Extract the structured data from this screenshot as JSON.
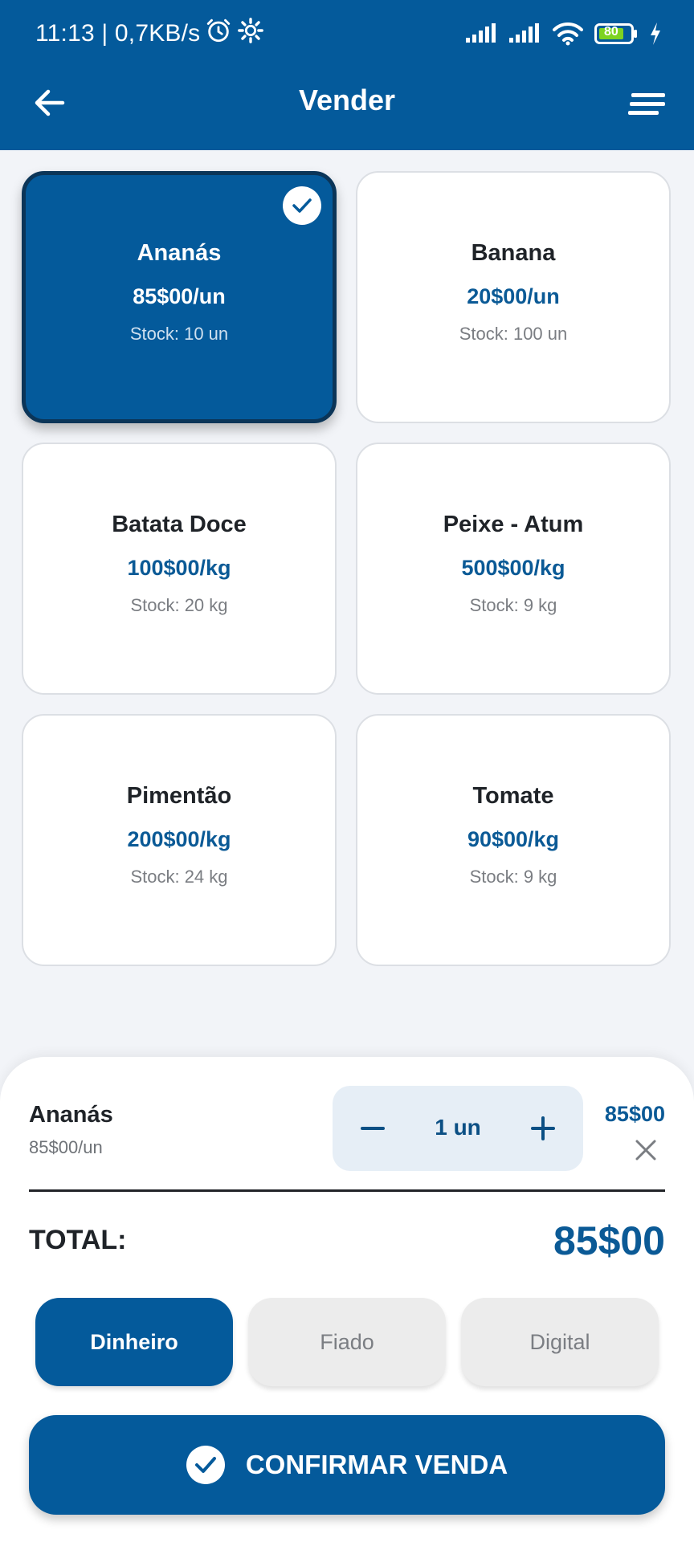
{
  "status_bar": {
    "time_speed": "11:13 | 0,7KB/s",
    "battery": "80",
    "icons": [
      "alarm-icon",
      "settings-icon",
      "signal-icon",
      "signal-icon",
      "wifi-icon",
      "battery-icon",
      "charging-icon"
    ]
  },
  "app_bar": {
    "title": "Vender",
    "back_icon": "arrow-left-icon",
    "menu_icon": "sort-menu-icon"
  },
  "products": [
    {
      "name": "Ananás",
      "price": "85$00/un",
      "stock": "Stock: 10 un",
      "selected": true
    },
    {
      "name": "Banana",
      "price": "20$00/un",
      "stock": "Stock: 100 un",
      "selected": false
    },
    {
      "name": "Batata Doce",
      "price": "100$00/kg",
      "stock": "Stock: 20 kg",
      "selected": false
    },
    {
      "name": "Peixe - Atum",
      "price": "500$00/kg",
      "stock": "Stock: 9 kg",
      "selected": false
    },
    {
      "name": "Pimentão",
      "price": "200$00/kg",
      "stock": "Stock: 24 kg",
      "selected": false
    },
    {
      "name": "Tomate",
      "price": "90$00/kg",
      "stock": "Stock: 9 kg",
      "selected": false
    }
  ],
  "cart": {
    "item": {
      "name": "Ananás",
      "unit_price": "85$00/un",
      "quantity": "1 un",
      "total": "85$00"
    },
    "total_label": "TOTAL:",
    "total_value": "85$00"
  },
  "payment_methods": [
    {
      "label": "Dinheiro",
      "active": true
    },
    {
      "label": "Fiado",
      "active": false
    },
    {
      "label": "Digital",
      "active": false
    }
  ],
  "confirm_label": "CONFIRMAR VENDA",
  "colors": {
    "primary": "#045a9b",
    "primary_dark": "#0b3558",
    "price_text": "#0b5a96",
    "background": "#f2f4f8"
  }
}
